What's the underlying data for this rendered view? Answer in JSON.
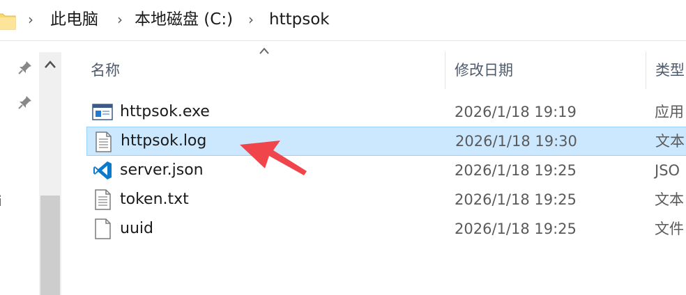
{
  "breadcrumb": {
    "items": [
      "此电脑",
      "本地磁盘 (C:)",
      "httpsok"
    ],
    "separator": "›"
  },
  "navpane": {
    "partial_text": "i"
  },
  "columns": {
    "name": "名称",
    "date": "修改日期",
    "type": "类型"
  },
  "files": [
    {
      "name": "httpsok.exe",
      "date": "2026/1/18 19:19",
      "type": "应用",
      "icon": "exe-icon"
    },
    {
      "name": "httpsok.log",
      "date": "2026/1/18 19:30",
      "type": "文本",
      "icon": "text-file-icon",
      "selected": true
    },
    {
      "name": "server.json",
      "date": "2026/1/18 19:25",
      "type": "JSO",
      "icon": "vscode-icon"
    },
    {
      "name": "token.txt",
      "date": "2026/1/18 19:25",
      "type": "文本",
      "icon": "text-file-icon"
    },
    {
      "name": "uuid",
      "date": "2026/1/18 19:25",
      "type": "文件",
      "icon": "blank-file-icon"
    }
  ],
  "colors": {
    "selection_bg": "#cce8ff",
    "selection_border": "#99d1ff",
    "annotation_arrow": "#f0464b",
    "vscode_blue": "#0a7acc"
  }
}
